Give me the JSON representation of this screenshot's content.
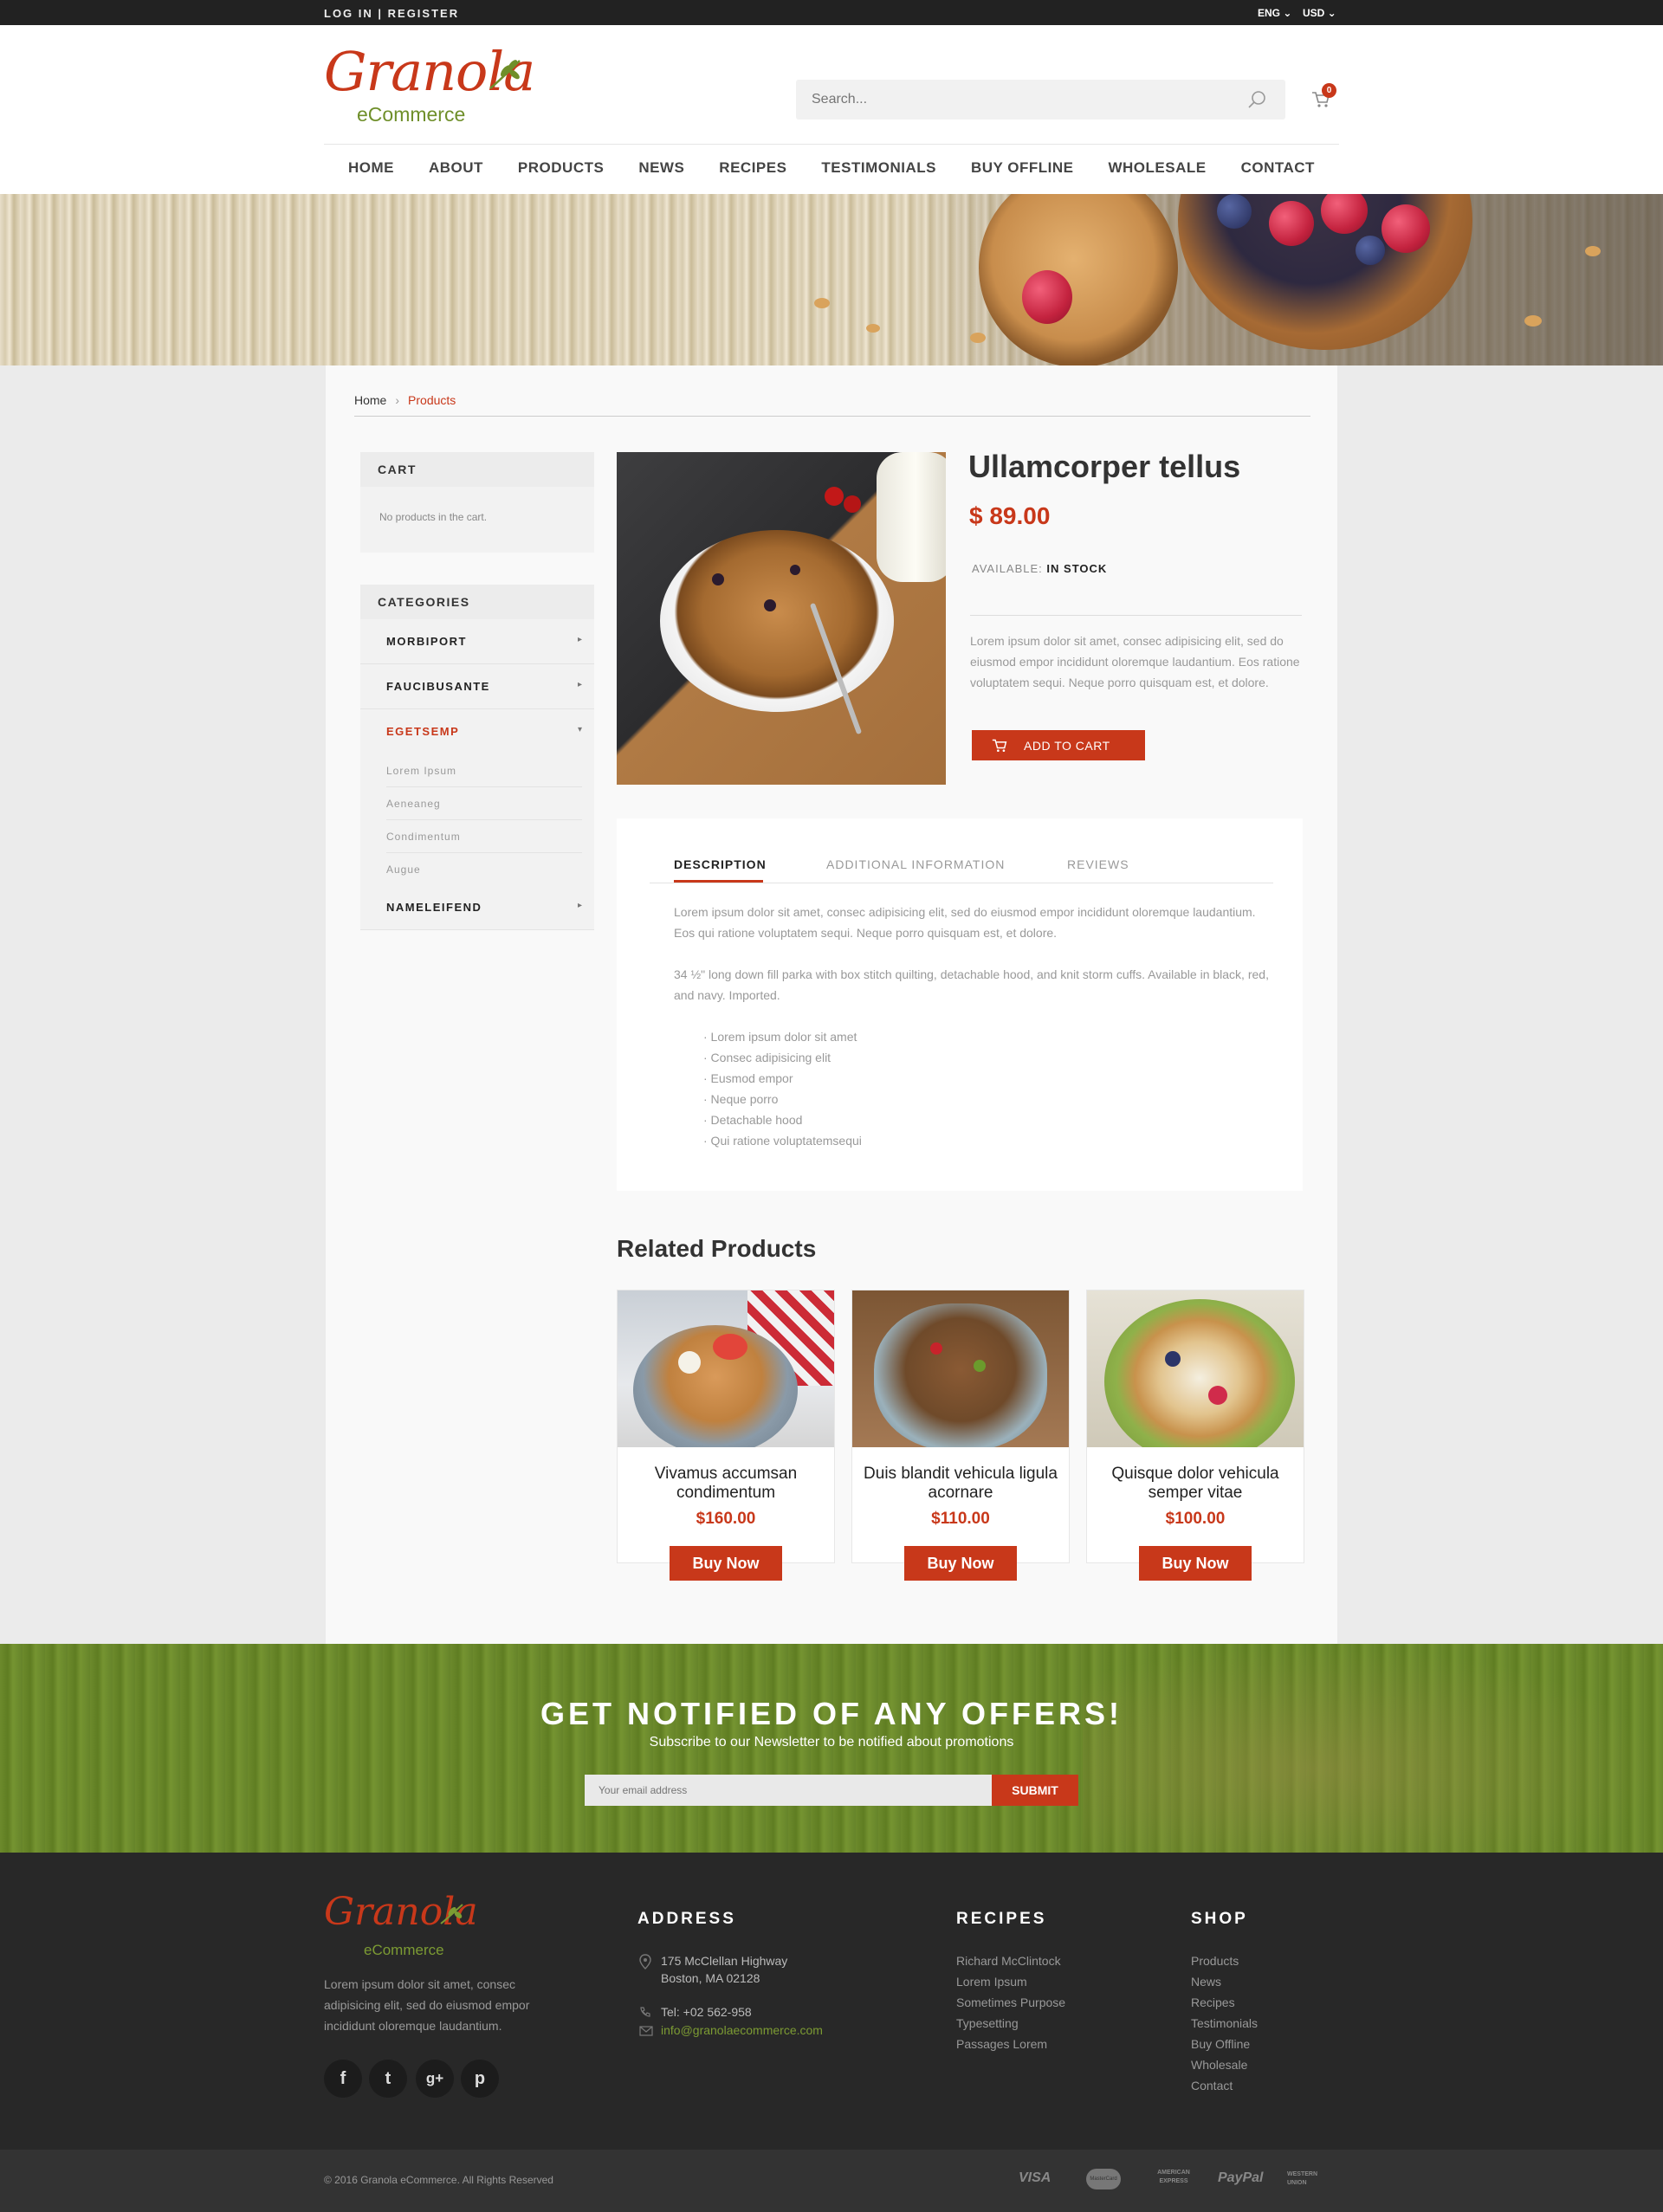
{
  "topbar": {
    "login": "LOG IN | REGISTER",
    "language": "ENG",
    "currency": "USD"
  },
  "brand": {
    "name": "Granola",
    "sub": "eCommerce",
    "color": "#c8381a",
    "accent": "#6f8f2a"
  },
  "search": {
    "placeholder": "Search..."
  },
  "cart": {
    "count": "0"
  },
  "nav": [
    "HOME",
    "ABOUT",
    "PRODUCTS",
    "NEWS",
    "RECIPES",
    "TESTIMONIALS",
    "BUY OFFLINE",
    "WHOLESALE",
    "CONTACT"
  ],
  "breadcrumb": {
    "home": "Home",
    "current": "Products"
  },
  "sidebar": {
    "cart_title": "CART",
    "cart_empty": "No products in the cart.",
    "categories_title": "CATEGORIES",
    "categories": [
      {
        "label": "MORBIPORT",
        "arrow": "▸"
      },
      {
        "label": "FAUCIBUSANTE",
        "arrow": "▸"
      },
      {
        "label": "EGETSEMP",
        "arrow": "▾",
        "active": true
      },
      {
        "label": "NAMELEIFEND",
        "arrow": "▸"
      }
    ],
    "subcategories": [
      "Lorem Ipsum",
      "Aeneaneg",
      "Condimentum",
      "Augue"
    ]
  },
  "product": {
    "title": "Ullamcorper tellus",
    "price": "$ 89.00",
    "available_label": "AVAILABLE:",
    "available_value": "IN STOCK",
    "description": "Lorem ipsum dolor sit amet, consec adipisicing elit, sed do eiusmod empor incididunt oloremque laudantium. Eos ratione voluptatem sequi. Neque porro quisquam est, et dolore.",
    "add_to_cart": "ADD TO CART"
  },
  "tabs": {
    "items": [
      "DESCRIPTION",
      "ADDITIONAL INFORMATION",
      "REVIEWS"
    ],
    "para1": "Lorem ipsum dolor sit amet, consec adipisicing elit, sed do eiusmod empor incididunt oloremque laudantium. Eos qui ratione voluptatem sequi. Neque porro quisquam est, et dolore.",
    "para2": "34 ½\" long down fill parka with box stitch quilting, detachable hood, and knit storm cuffs. Available in black, red, and navy. Imported.",
    "bullets": [
      "· Lorem ipsum dolor sit amet",
      "· Consec adipisicing elit",
      "· Eusmod empor",
      "· Neque porro",
      "· Detachable hood",
      "· Qui ratione voluptatemsequi"
    ]
  },
  "related": {
    "title": "Related Products",
    "items": [
      {
        "name": "Vivamus accumsan condimentum",
        "price": "$160.00",
        "button": "Buy Now"
      },
      {
        "name": "Duis blandit vehicula ligula acornare",
        "price": "$110.00",
        "button": "Buy Now"
      },
      {
        "name": "Quisque dolor vehicula semper vitae",
        "price": "$100.00",
        "button": "Buy Now"
      }
    ]
  },
  "newsletter": {
    "title": "GET NOTIFIED OF ANY OFFERS!",
    "subtitle": "Subscribe to our Newsletter to be notified about promotions",
    "placeholder": "Your email address",
    "button": "SUBMIT"
  },
  "footer": {
    "about": "Lorem ipsum dolor sit amet, consec adipisicing elit, sed do eiusmod empor incididunt oloremque laudantium.",
    "social": [
      "f",
      "t",
      "g+",
      "p"
    ],
    "address_title": "ADDRESS",
    "address_line1": "175 McClellan Highway",
    "address_line2": "Boston, MA 02128",
    "phone": "Tel: +02 562-958",
    "email": "info@granolaecommerce.com",
    "recipes_title": "RECIPES",
    "recipes": [
      "Richard McClintock",
      "Lorem Ipsum",
      "Sometimes Purpose",
      "Typesetting",
      "Passages  Lorem"
    ],
    "shop_title": "SHOP",
    "shop": [
      "Products",
      "News",
      "Recipes",
      "Testimonials",
      "Buy Offline",
      "Wholesale",
      "Contact"
    ],
    "copyright": "© 2016 Granola eCommerce. All Rights Reserved",
    "payments": [
      "VISA",
      "MasterCard",
      "AMERICAN EXPRESS",
      "PayPal",
      "WESTERN UNION"
    ]
  }
}
